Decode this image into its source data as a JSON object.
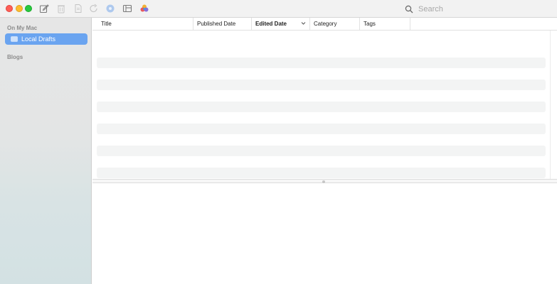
{
  "search": {
    "placeholder": "Search"
  },
  "sidebar": {
    "section_local": "On My Mac",
    "selected_item": "Local Drafts",
    "section_blogs": "Blogs"
  },
  "table": {
    "columns": [
      {
        "label": "Title"
      },
      {
        "label": "Published Date"
      },
      {
        "label": "Edited Date",
        "sorted": "descending"
      },
      {
        "label": "Category"
      },
      {
        "label": "Tags"
      }
    ]
  },
  "colors": {
    "selection": "#6aa4f0",
    "close": "#ff5f57",
    "minimize": "#febc2e",
    "maximize": "#28c840"
  },
  "toolbar_icons": [
    "new-post-icon",
    "trash-icon",
    "document-icon",
    "refresh-icon",
    "blog-icon",
    "layout-icon",
    "palette-icon"
  ]
}
